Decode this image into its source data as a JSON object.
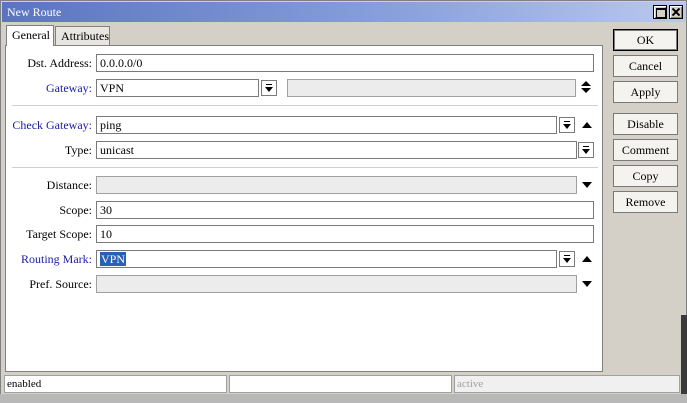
{
  "window": {
    "title": "New Route"
  },
  "tabs": [
    {
      "label": "General",
      "active": true
    },
    {
      "label": "Attributes",
      "active": false
    }
  ],
  "fields": {
    "dst_address": {
      "label": "Dst. Address:",
      "value": "0.0.0.0/0"
    },
    "gateway": {
      "label": "Gateway:",
      "value": "VPN",
      "secondary_value": ""
    },
    "check_gateway": {
      "label": "Check Gateway:",
      "value": "ping"
    },
    "type": {
      "label": "Type:",
      "value": "unicast"
    },
    "distance": {
      "label": "Distance:",
      "value": ""
    },
    "scope": {
      "label": "Scope:",
      "value": "30"
    },
    "target_scope": {
      "label": "Target Scope:",
      "value": "10"
    },
    "routing_mark": {
      "label": "Routing Mark:",
      "value": "VPN"
    },
    "pref_source": {
      "label": "Pref. Source:",
      "value": ""
    }
  },
  "buttons": {
    "ok": "OK",
    "cancel": "Cancel",
    "apply": "Apply",
    "disable": "Disable",
    "comment": "Comment",
    "copy": "Copy",
    "remove": "Remove"
  },
  "status": {
    "left": "enabled",
    "middle": "",
    "right": "active"
  },
  "colors": {
    "link_label": "#1a1aa6",
    "title_gradient_start": "#5b74c0",
    "selection": "#2b5fb4"
  }
}
